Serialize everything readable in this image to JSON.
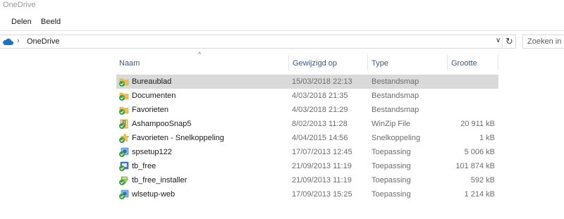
{
  "window": {
    "title": "OneDrive"
  },
  "ribbon": {
    "tabs": [
      "Delen",
      "Beeld"
    ]
  },
  "address": {
    "crumb": "OneDrive"
  },
  "search": {
    "placeholder": "Zoeken in"
  },
  "columns": {
    "name": "Naam",
    "modified": "Gewijzigd op",
    "type": "Type",
    "size": "Grootte"
  },
  "rows": [
    {
      "name": "Bureaublad",
      "modified": "15/03/2018 22:13",
      "type": "Bestandsmap",
      "size": "",
      "icon": "folder-synced-icon",
      "selected": true
    },
    {
      "name": "Documenten",
      "modified": "4/03/2018 21:35",
      "type": "Bestandsmap",
      "size": "",
      "icon": "folder-synced-icon"
    },
    {
      "name": "Favorieten",
      "modified": "4/03/2018 21:29",
      "type": "Bestandsmap",
      "size": "",
      "icon": "folder-synced-icon"
    },
    {
      "name": "AshampooSnap5",
      "modified": "8/02/2013 11:28",
      "type": "WinZip File",
      "size": "20 911 kB",
      "icon": "winzip-file-icon"
    },
    {
      "name": "Favorieten - Snelkoppeling",
      "modified": "4/04/2015 14:56",
      "type": "Snelkoppeling",
      "size": "1 kB",
      "icon": "shortcut-star-icon"
    },
    {
      "name": "spsetup122",
      "modified": "17/07/2013 12:45",
      "type": "Toepassing",
      "size": "5 006 kB",
      "icon": "setup-app-icon"
    },
    {
      "name": "tb_free",
      "modified": "21/09/2013 11:19",
      "type": "Toepassing",
      "size": "101 874 kB",
      "icon": "app-exe-icon"
    },
    {
      "name": "tb_free_installer",
      "modified": "21/09/2013 11:19",
      "type": "Toepassing",
      "size": "592 kB",
      "icon": "installer-app-icon"
    },
    {
      "name": "wlsetup-web",
      "modified": "17/09/2013 15:25",
      "type": "Toepassing",
      "size": "1 214 kB",
      "icon": "setup-app-icon"
    }
  ],
  "colors": {
    "selected_row": "#d9d9d9",
    "header_text": "#3c5a8a",
    "sync_check": "#3a9c3a",
    "folder": "#e8c15a",
    "onedrive_cloud": "#1a73c9"
  }
}
